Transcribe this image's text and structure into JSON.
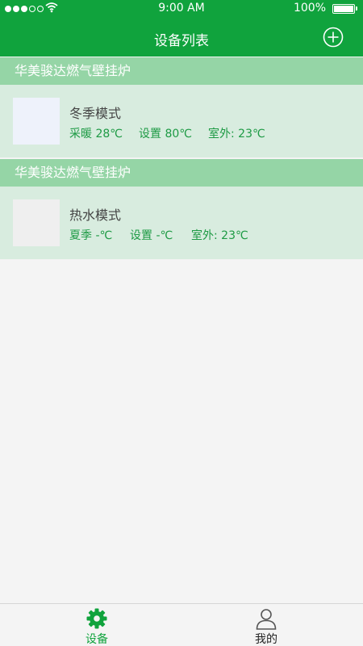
{
  "status_bar": {
    "time": "9:00 AM",
    "battery_text": "100%"
  },
  "nav": {
    "title": "设备列表",
    "add_icon": "plus-circle-icon"
  },
  "devices": [
    {
      "group_title": "华美骏达燃气壁挂炉",
      "mode": "冬季模式",
      "stats": [
        "采暖 28℃",
        "设置 80℃",
        "室外: 23℃"
      ]
    },
    {
      "group_title": "华美骏达燃气壁挂炉",
      "mode": "热水模式",
      "stats": [
        "夏季 -℃",
        "设置 -℃",
        "室外: 23℃"
      ]
    }
  ],
  "tabbar": {
    "tabs": [
      {
        "label": "设备",
        "icon": "gear-icon",
        "active": true
      },
      {
        "label": "我的",
        "icon": "person-icon",
        "active": false
      }
    ]
  },
  "colors": {
    "primary": "#10a33d",
    "group_header_bg": "#95d5a6",
    "card_bg": "#d8ecdf",
    "stat_text": "#1d9a44",
    "page_bg": "#f4f4f4"
  }
}
